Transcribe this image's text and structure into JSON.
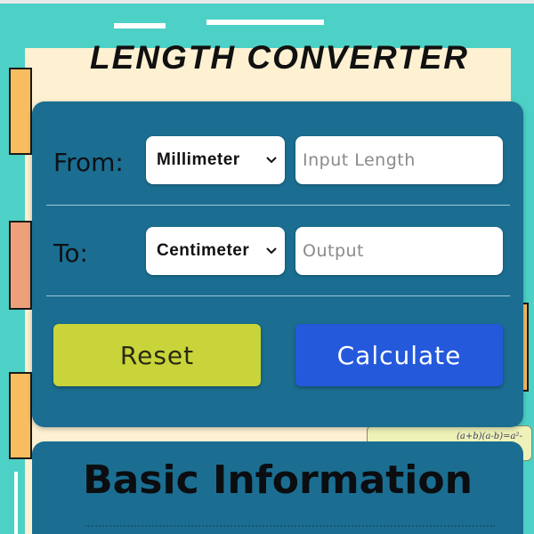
{
  "page": {
    "title": "LENGTH CONVERTER"
  },
  "converter": {
    "from_label": "From:",
    "to_label": "To:",
    "from_unit": "Millimeter",
    "to_unit": "Centimeter",
    "input_placeholder": "Input Length",
    "output_placeholder": "Output",
    "input_value": "",
    "output_value": "",
    "reset_label": "Reset",
    "calculate_label": "Calculate"
  },
  "info": {
    "heading": "Basic Information"
  },
  "colors": {
    "background": "#4dd1c6",
    "card": "#1b6e91",
    "reset_button": "#c9d43a",
    "calculate_button": "#2459dc",
    "paper": "#fdf1d2"
  },
  "icons": {
    "select_arrow": "chevron-down-icon"
  }
}
